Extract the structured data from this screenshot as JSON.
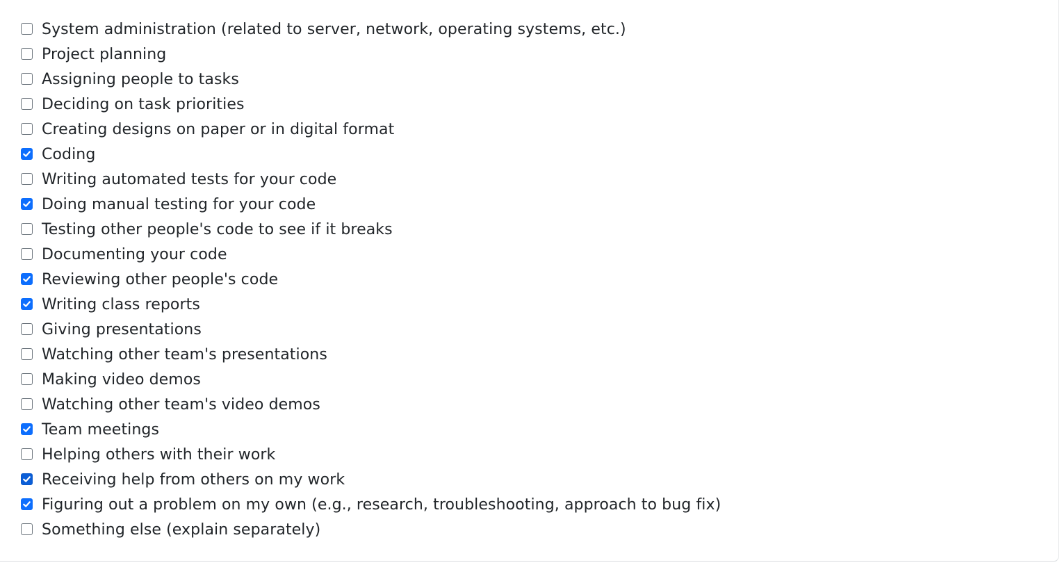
{
  "options": [
    {
      "label": "System administration (related to server, network, operating systems, etc.)",
      "checked": false
    },
    {
      "label": "Project planning",
      "checked": false
    },
    {
      "label": "Assigning people to tasks",
      "checked": false
    },
    {
      "label": "Deciding on task priorities",
      "checked": false
    },
    {
      "label": "Creating designs on paper or in digital format",
      "checked": false
    },
    {
      "label": "Coding",
      "checked": true
    },
    {
      "label": "Writing automated tests for your code",
      "checked": false
    },
    {
      "label": "Doing manual testing for your code",
      "checked": true
    },
    {
      "label": "Testing other people's code to see if it breaks",
      "checked": false
    },
    {
      "label": "Documenting your code",
      "checked": false
    },
    {
      "label": "Reviewing other people's code",
      "checked": true
    },
    {
      "label": "Writing class reports",
      "checked": true
    },
    {
      "label": "Giving presentations",
      "checked": false
    },
    {
      "label": "Watching other team's presentations",
      "checked": false
    },
    {
      "label": "Making video demos",
      "checked": false
    },
    {
      "label": "Watching other team's video demos",
      "checked": false
    },
    {
      "label": "Team meetings",
      "checked": true
    },
    {
      "label": "Helping others with their work",
      "checked": false
    },
    {
      "label": "Receiving help from others on my work",
      "checked": true,
      "focused": true
    },
    {
      "label": "Figuring out a problem on my own (e.g., research, troubleshooting, approach to bug fix)",
      "checked": true
    },
    {
      "label": "Something else (explain separately)",
      "checked": false
    }
  ],
  "colors": {
    "checked": "#0d6efd",
    "checked_focused": "#0b5ed7",
    "unchecked_border": "#6c757d",
    "text": "#212529"
  }
}
